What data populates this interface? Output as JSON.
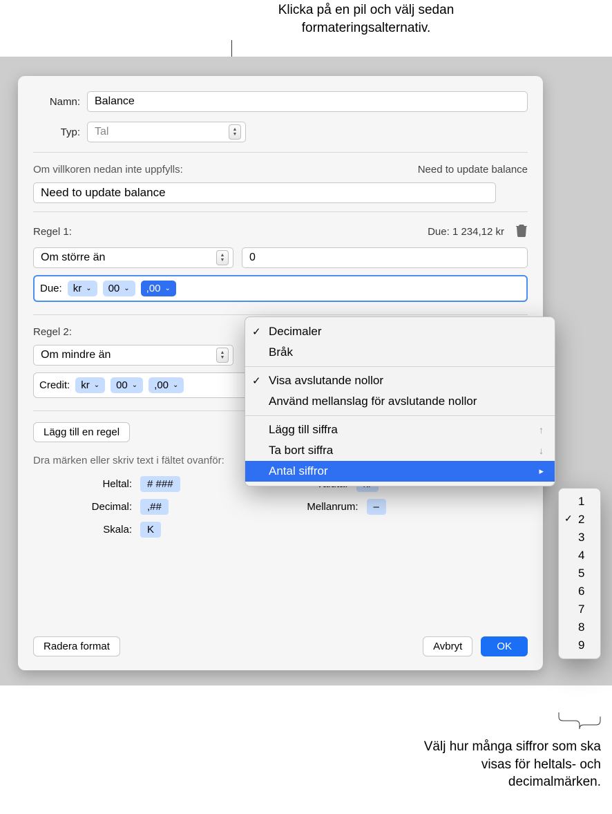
{
  "callouts": {
    "top": "Klicka på en pil och välj sedan formateringsalternativ.",
    "bottom": "Välj hur många siffror som ska visas för heltals- och decimalmärken."
  },
  "panel": {
    "name_label": "Namn:",
    "name_value": "Balance",
    "type_label": "Typ:",
    "type_value": "Tal",
    "cond_text": "Om villkoren nedan inte uppfylls:",
    "cond_preview": "Need to update balance",
    "cond_input_value": "Need to update balance"
  },
  "rules": [
    {
      "header": "Regel 1:",
      "preview": "Due: 1 234,12 kr",
      "op": "Om större än",
      "value": "0",
      "prefix": "Due:",
      "tokens": [
        "kr",
        "00",
        ",00"
      ],
      "selected_index": 2
    },
    {
      "header": "Regel 2:",
      "op": "Om mindre än",
      "prefix": "Credit:",
      "tokens": [
        "kr",
        "00",
        ",00"
      ]
    }
  ],
  "add_rule_label": "Lägg till en regel",
  "help_text": "Dra märken eller skriv text i fältet ovanför:",
  "swatches": {
    "heltal": {
      "label": "Heltal:",
      "value": "# ###"
    },
    "decimal": {
      "label": "Decimal:",
      "value": ",##"
    },
    "skala": {
      "label": "Skala:",
      "value": "K"
    },
    "valuta": {
      "label": "Valuta:",
      "value": "kr"
    },
    "mellanrum": {
      "label": "Mellanrum:",
      "value": "–"
    }
  },
  "footer": {
    "delete": "Radera format",
    "cancel": "Avbryt",
    "ok": "OK"
  },
  "menu": {
    "decimaler": "Decimaler",
    "brak": "Bråk",
    "visa_nollor": "Visa avslutande nollor",
    "anvand_mellanslag": "Använd mellanslag för avslutande nollor",
    "lagg_till": "Lägg till siffra",
    "ta_bort": "Ta bort siffra",
    "antal": "Antal siffror"
  },
  "submenu": {
    "items": [
      "1",
      "2",
      "3",
      "4",
      "5",
      "6",
      "7",
      "8",
      "9"
    ],
    "checked": "2"
  }
}
